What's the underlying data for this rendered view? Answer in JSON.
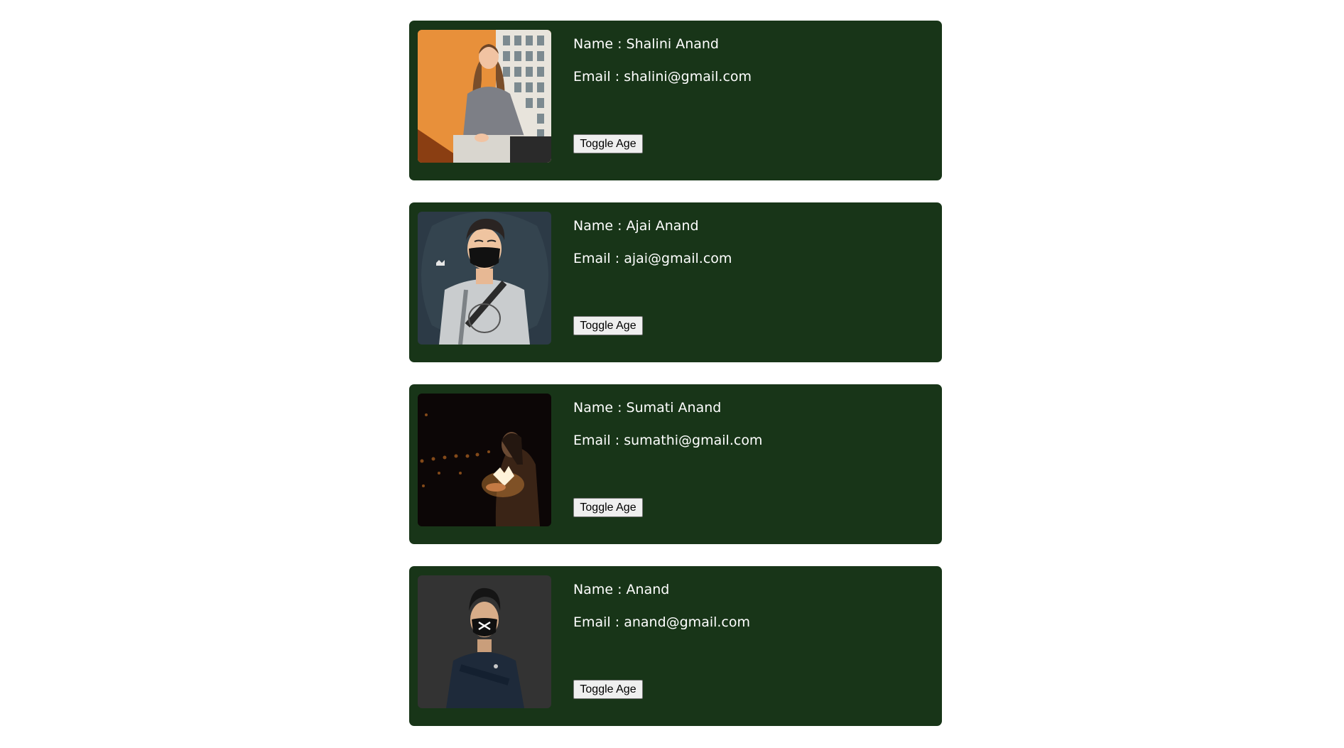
{
  "theme": {
    "card_bg": "#183518",
    "text": "#ffffff"
  },
  "users": [
    {
      "name": "Name : Shalini Anand",
      "email": "Email : shalini@gmail.com",
      "button": "Toggle Age"
    },
    {
      "name": "Name : Ajai Anand",
      "email": "Email : ajai@gmail.com",
      "button": "Toggle Age"
    },
    {
      "name": "Name : Sumati Anand",
      "email": "Email : sumathi@gmail.com",
      "button": "Toggle Age"
    },
    {
      "name": "Name : Anand",
      "email": "Email : anand@gmail.com",
      "button": "Toggle Age"
    }
  ]
}
